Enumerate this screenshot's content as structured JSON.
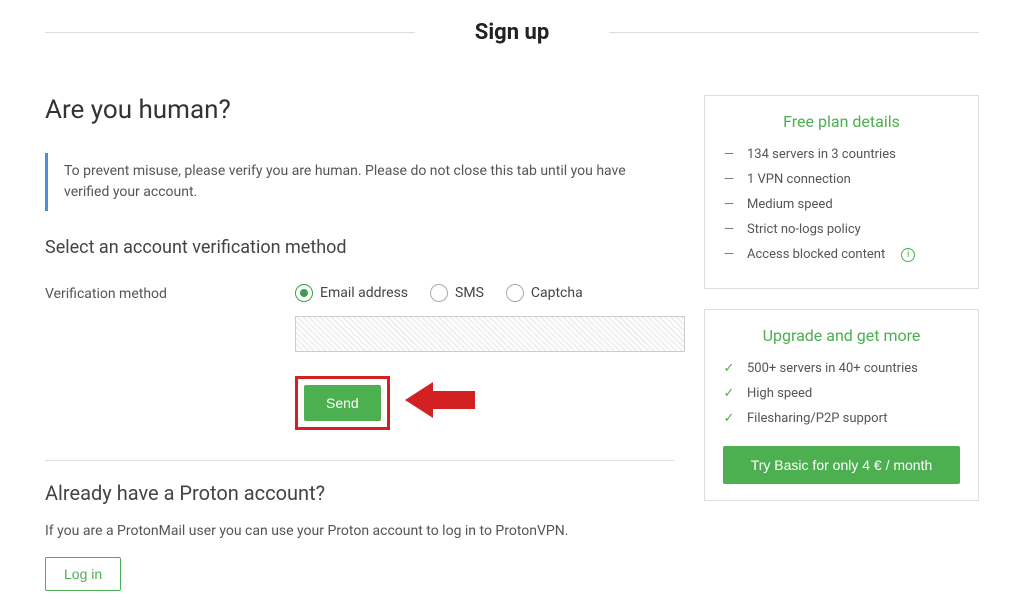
{
  "header": {
    "title": "Sign up"
  },
  "main": {
    "heading": "Are you human?",
    "alert": "To prevent misuse, please verify you are human. Please do not close this tab until you have verified your account.",
    "section_title": "Select an account verification method",
    "verification_label": "Verification method",
    "radios": {
      "email": "Email address",
      "sms": "SMS",
      "captcha": "Captcha"
    },
    "input_value": "",
    "send_label": "Send"
  },
  "already": {
    "heading": "Already have a Proton account?",
    "text": "If you are a ProtonMail user you can use your Proton account to log in to ProtonVPN.",
    "login_label": "Log in"
  },
  "free_panel": {
    "title": "Free plan details",
    "items": [
      "134 servers in 3 countries",
      "1 VPN connection",
      "Medium speed",
      "Strict no-logs policy",
      "Access blocked content"
    ]
  },
  "upgrade_panel": {
    "title": "Upgrade and get more",
    "items": [
      "500+ servers in 40+ countries",
      "High speed",
      "Filesharing/P2P support"
    ],
    "button": "Try Basic for only 4 € / month"
  }
}
